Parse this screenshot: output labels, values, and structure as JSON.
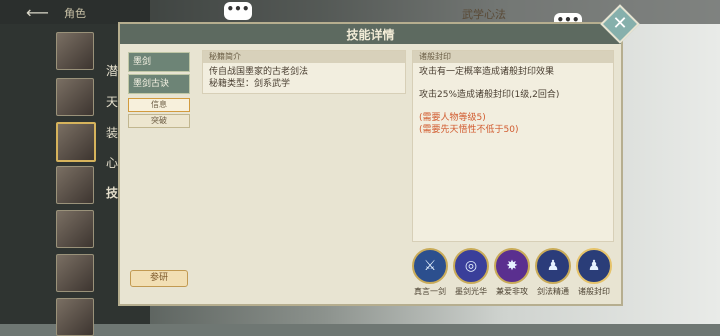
{
  "header": {
    "back_icon": "back-arrow-icon",
    "title": "角色"
  },
  "roster": {
    "side_labels": [
      "潜",
      "天",
      "装",
      "心",
      "技"
    ]
  },
  "right_title": "武学心法",
  "chat_bubble": "•••",
  "modal": {
    "title": "技能详情",
    "tabs": [
      {
        "label": "墨剑"
      },
      {
        "label": "墨剑古诀"
      }
    ],
    "subtabs": [
      {
        "label": "信息"
      },
      {
        "label": "突破"
      }
    ],
    "research_button": "参研",
    "intro": {
      "header": "秘籍简介",
      "lines": [
        "传自战国墨家的古老剑法",
        "秘籍类型：剑系武学"
      ]
    },
    "effect": {
      "header": "诸般封印",
      "lines": [
        "攻击有一定概率造成诸般封印效果",
        "攻击25%造成诸般封印(1级,2回合)"
      ],
      "requirements": [
        "(需要人物等级5)",
        "(需要先天悟性不低于50)"
      ]
    },
    "skills": [
      {
        "name": "真言一剑",
        "icon": "sword-slash-icon",
        "color": "#2c4f8e"
      },
      {
        "name": "墨剑光华",
        "icon": "swirl-blade-icon",
        "color": "#3a3f9a"
      },
      {
        "name": "兼爱非攻",
        "icon": "star-burst-icon",
        "color": "#5a2f8f"
      },
      {
        "name": "剑法精通",
        "icon": "figure-icon",
        "color": "#2b3c7a"
      },
      {
        "name": "诸般封印",
        "icon": "figure-icon",
        "color": "#2a3d78"
      }
    ]
  }
}
